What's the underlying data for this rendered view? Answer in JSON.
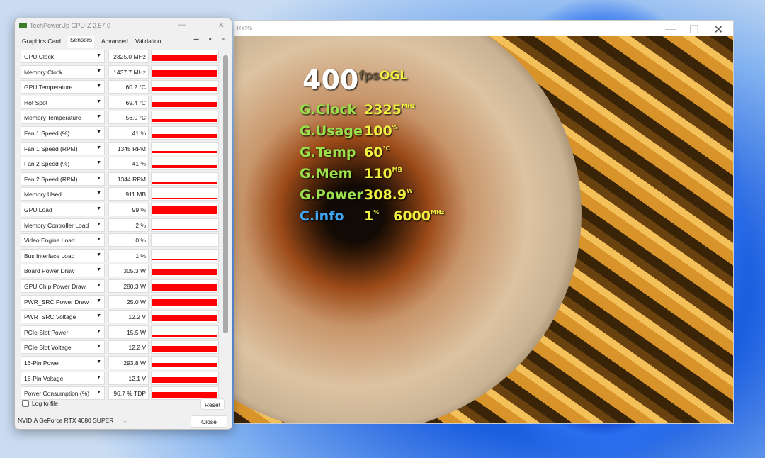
{
  "gpuz": {
    "title": "TechPowerUp GPU-Z 2.57.0",
    "tabs": [
      "Graphics Card",
      "Sensors",
      "Advanced",
      "Validation"
    ],
    "active_tab": "Sensors",
    "sensors": [
      {
        "label": "GPU Clock",
        "value": "2325.0 MHz",
        "level": 0.6
      },
      {
        "label": "Memory Clock",
        "value": "1437.7 MHz",
        "level": 0.55
      },
      {
        "label": "GPU Temperature",
        "value": "60.2 °C",
        "level": 0.4
      },
      {
        "label": "Hot Spot",
        "value": "69.4 °C",
        "level": 0.45
      },
      {
        "label": "Memory Temperature",
        "value": "56.0 °C",
        "level": 0.3
      },
      {
        "label": "Fan 1 Speed (%)",
        "value": "41 %",
        "level": 0.35
      },
      {
        "label": "Fan 1 Speed (RPM)",
        "value": "1345 RPM",
        "level": 0.2
      },
      {
        "label": "Fan 2 Speed (%)",
        "value": "41 %",
        "level": 0.3
      },
      {
        "label": "Fan 2 Speed (RPM)",
        "value": "1344 RPM",
        "level": 0.15
      },
      {
        "label": "Memory Used",
        "value": "911 MB",
        "level": 0.05
      },
      {
        "label": "GPU Load",
        "value": "99 %",
        "level": 0.75
      },
      {
        "label": "Memory Controller Load",
        "value": "2 %",
        "level": 0.05
      },
      {
        "label": "Video Engine Load",
        "value": "0 %",
        "level": 0
      },
      {
        "label": "Bus Interface Load",
        "value": "1 %",
        "level": 0.02
      },
      {
        "label": "Board Power Draw",
        "value": "305.3 W",
        "level": 0.55
      },
      {
        "label": "GPU Chip Power Draw",
        "value": "280.3 W",
        "level": 0.6
      },
      {
        "label": "PWR_SRC Power Draw",
        "value": "25.0 W",
        "level": 0.65
      },
      {
        "label": "PWR_SRC Voltage",
        "value": "12.2 V",
        "level": 0.55
      },
      {
        "label": "PCIe Slot Power",
        "value": "15.5 W",
        "level": 0.15
      },
      {
        "label": "PCIe Slot Voltage",
        "value": "12.2 V",
        "level": 0.55
      },
      {
        "label": "16-Pin Power",
        "value": "293.8 W",
        "level": 0.4
      },
      {
        "label": "16-Pin Voltage",
        "value": "12.1 V",
        "level": 0.5
      },
      {
        "label": "Power Consumption (%)",
        "value": "96.7 % TDP",
        "level": 0.55
      }
    ],
    "log_to_file": "Log to file",
    "log_checked": false,
    "reset": "Reset",
    "gpu_select": "NVIDIA GeForce RTX 4080 SUPER",
    "close": "Close",
    "bar_color": "#ff0000"
  },
  "render": {
    "title": "100%",
    "osd": {
      "fps": "400",
      "fps_unit": "fps",
      "api": "OGL",
      "lines": [
        {
          "label": "G.Clock",
          "value": "2325",
          "unit": "MHz"
        },
        {
          "label": "G.Usage",
          "value": "100",
          "unit": "%"
        },
        {
          "label": "G.Temp",
          "value": "60",
          "unit": "°C"
        },
        {
          "label": "G.Mem",
          "value": "110",
          "unit": "MB"
        },
        {
          "label": "G.Power",
          "value": "308.9",
          "unit": "W"
        }
      ],
      "cinfo": {
        "label": "C.info",
        "usage": "1",
        "usage_unit": "%",
        "clock": "6000",
        "clock_unit": "MHz"
      },
      "label_color": "#9be04a",
      "value_color": "#f0f040",
      "cpu_color": "#3fa9f5"
    }
  }
}
